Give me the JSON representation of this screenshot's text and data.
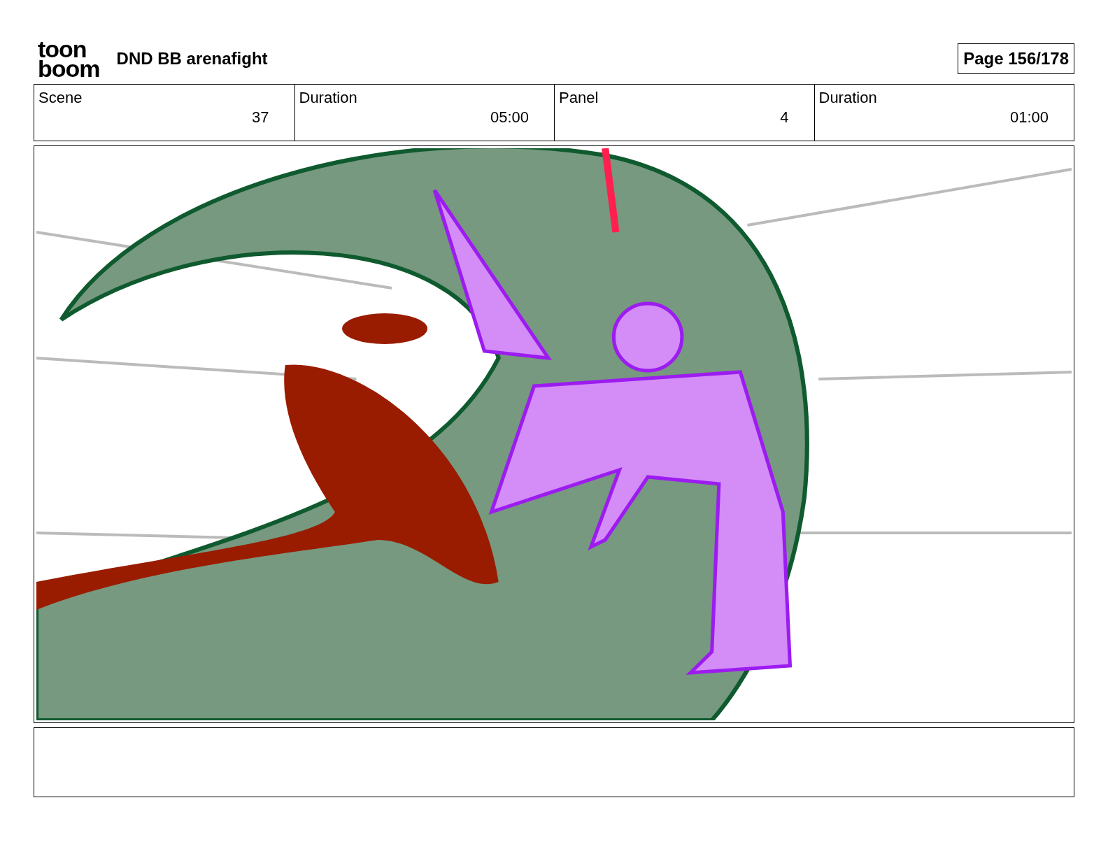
{
  "header": {
    "logo": [
      "toon",
      "boom"
    ],
    "title": "DND BB arenafight",
    "page": "Page 156/178"
  },
  "fields": [
    {
      "label": "Scene",
      "value": "37"
    },
    {
      "label": "Duration",
      "value": "05:00"
    },
    {
      "label": "Panel",
      "value": "4"
    },
    {
      "label": "Duration",
      "value": "01:00"
    }
  ]
}
